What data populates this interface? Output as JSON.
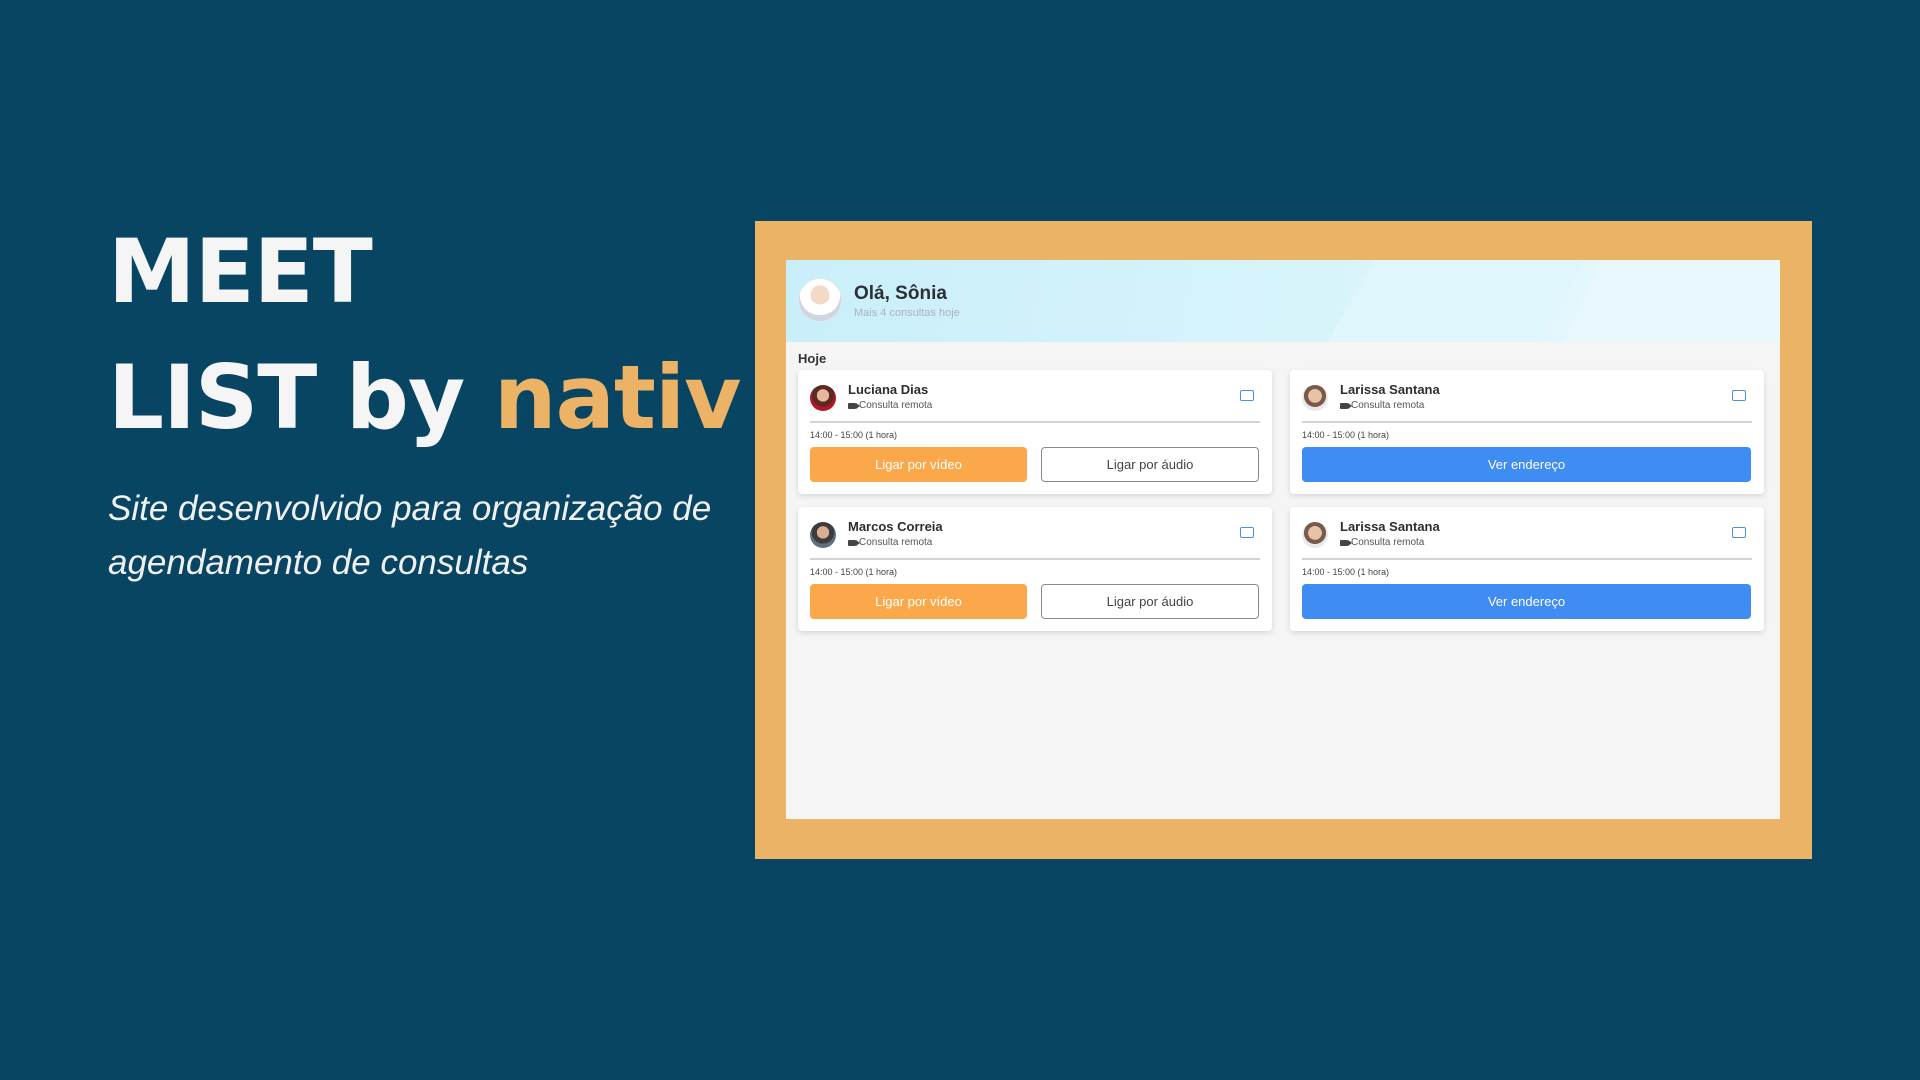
{
  "hero": {
    "line1": "MEET",
    "line2_prefix": "LIST by ",
    "line2_accent": "nativ",
    "subtitle": "Site desenvolvido para organização de agendamento de consultas"
  },
  "app": {
    "greeting": "Olá, Sônia",
    "greeting_sub": "Mais 4 consultas hoje",
    "section": "Hoje",
    "cards": [
      {
        "name": "Luciana Dias",
        "type": "Consulta remota",
        "time": "14:00 - 15:00 (1 hora)",
        "primary": "Ligar por vídeo",
        "secondary": "Ligar por áudio"
      },
      {
        "name": "Larissa Santana",
        "type": "Consulta remota",
        "time": "14:00 - 15:00 (1 hora)",
        "primary": "Ver endereço"
      },
      {
        "name": "Marcos Correia",
        "type": "Consulta remota",
        "time": "14:00 - 15:00 (1 hora)",
        "primary": "Ligar por vídeo",
        "secondary": "Ligar por áudio"
      },
      {
        "name": "Larissa Santana",
        "type": "Consulta remota",
        "time": "14:00 - 15:00 (1 hora)",
        "primary": "Ver endereço"
      }
    ]
  },
  "colors": {
    "background": "#074563",
    "accent": "#ecb265",
    "frame": "#ebb366",
    "video_button": "#fba84a",
    "address_button": "#3f8cf3"
  }
}
